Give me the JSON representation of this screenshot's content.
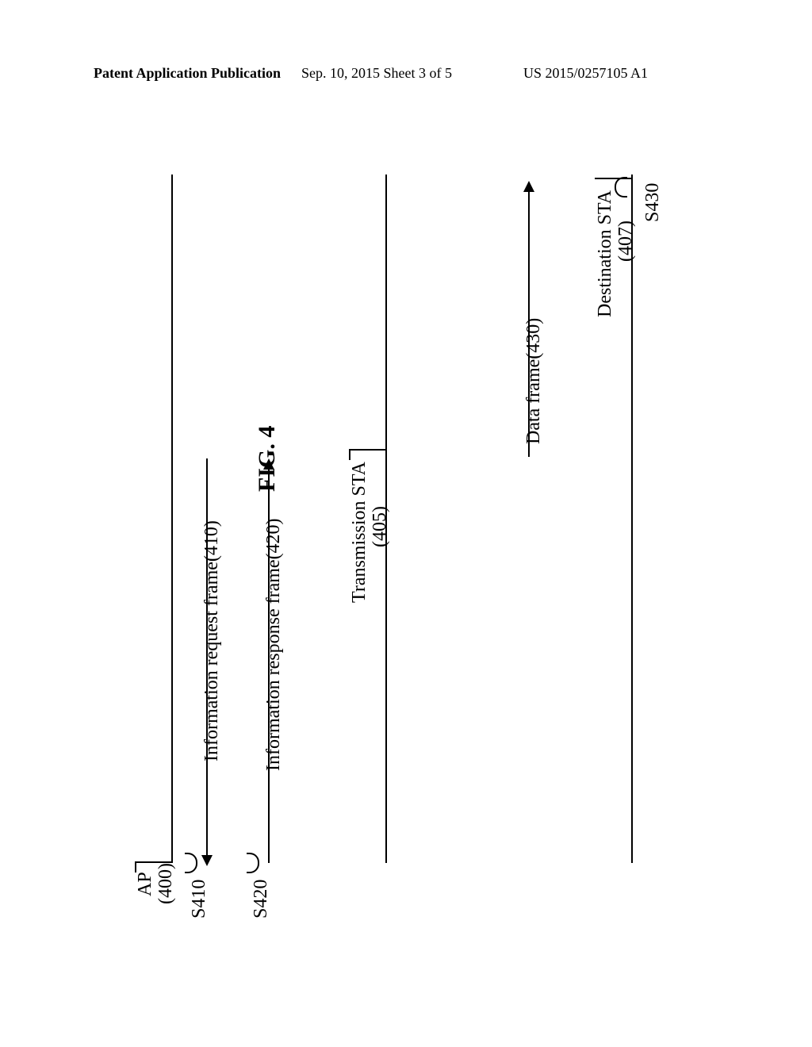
{
  "header": {
    "left": "Patent Application Publication",
    "center": "Sep. 10, 2015  Sheet 3 of 5",
    "right": "US 2015/0257105 A1"
  },
  "figure_label": "FIG. 4",
  "nodes": {
    "ap": {
      "title": "AP",
      "subtitle": "(400)"
    },
    "tx": {
      "title": "Transmission STA",
      "subtitle": "(405)"
    },
    "dst": {
      "title": "Destination STA",
      "subtitle": "(407)"
    }
  },
  "messages": {
    "req": "Information request frame(410)",
    "resp": "Information response frame(420)",
    "data": "Data frame(430)"
  },
  "steps": {
    "s410": "S410",
    "s420": "S420",
    "s430": "S430"
  }
}
